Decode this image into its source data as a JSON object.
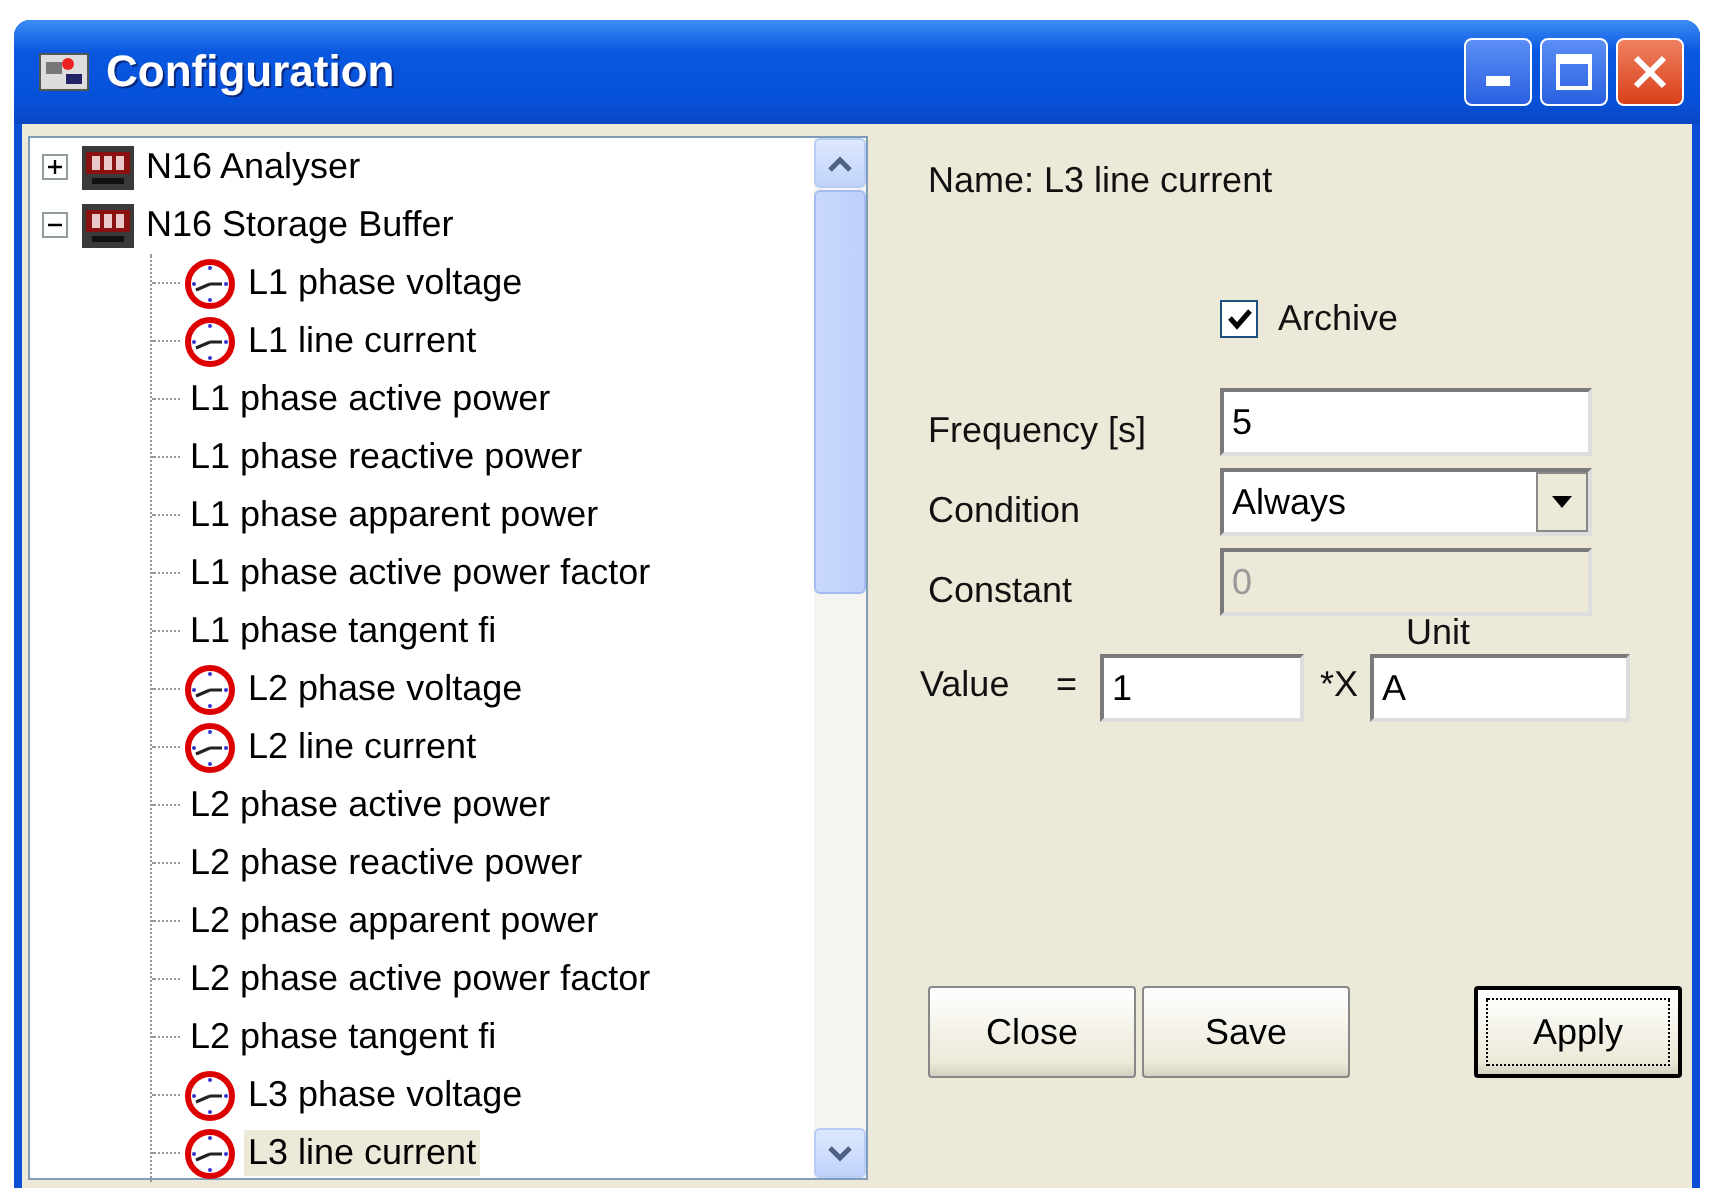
{
  "window": {
    "title": "Configuration"
  },
  "tree": [
    {
      "label": "N16 Analyser",
      "kind": "device",
      "expanded": false,
      "selected": false
    },
    {
      "label": "N16 Storage Buffer",
      "kind": "device",
      "expanded": true,
      "selected": false,
      "children": [
        {
          "label": "L1 phase voltage",
          "kind": "meter",
          "selected": false
        },
        {
          "label": "L1 line current",
          "kind": "meter",
          "selected": false
        },
        {
          "label": "L1 phase active power",
          "kind": "plain",
          "selected": false
        },
        {
          "label": "L1 phase reactive power",
          "kind": "plain",
          "selected": false
        },
        {
          "label": "L1 phase apparent power",
          "kind": "plain",
          "selected": false
        },
        {
          "label": "L1 phase active power factor",
          "kind": "plain",
          "selected": false
        },
        {
          "label": "L1 phase tangent fi",
          "kind": "plain",
          "selected": false
        },
        {
          "label": "L2 phase voltage",
          "kind": "meter",
          "selected": false
        },
        {
          "label": "L2 line current",
          "kind": "meter",
          "selected": false
        },
        {
          "label": "L2 phase active power",
          "kind": "plain",
          "selected": false
        },
        {
          "label": "L2 phase reactive power",
          "kind": "plain",
          "selected": false
        },
        {
          "label": "L2 phase apparent power",
          "kind": "plain",
          "selected": false
        },
        {
          "label": "L2 phase active power factor",
          "kind": "plain",
          "selected": false
        },
        {
          "label": "L2 phase tangent fi",
          "kind": "plain",
          "selected": false
        },
        {
          "label": "L3 phase voltage",
          "kind": "meter",
          "selected": false
        },
        {
          "label": "L3 line current",
          "kind": "meter",
          "selected": true
        }
      ]
    }
  ],
  "details": {
    "name": "Name: L3 line current",
    "archive": {
      "label": "Archive",
      "checked": true
    },
    "frequency": {
      "label": "Frequency [s]",
      "value": "5"
    },
    "condition": {
      "label": "Condition",
      "value": "Always"
    },
    "constant": {
      "label": "Constant",
      "value": "0",
      "disabled": true
    },
    "value": {
      "label": "Value",
      "equals": "=",
      "input": "1",
      "times": "*X",
      "unit_label": "Unit",
      "unit": "A"
    }
  },
  "buttons": [
    {
      "label": "Close",
      "default": false
    },
    {
      "label": "Save",
      "default": false
    },
    {
      "label": "Apply",
      "default": true
    }
  ]
}
